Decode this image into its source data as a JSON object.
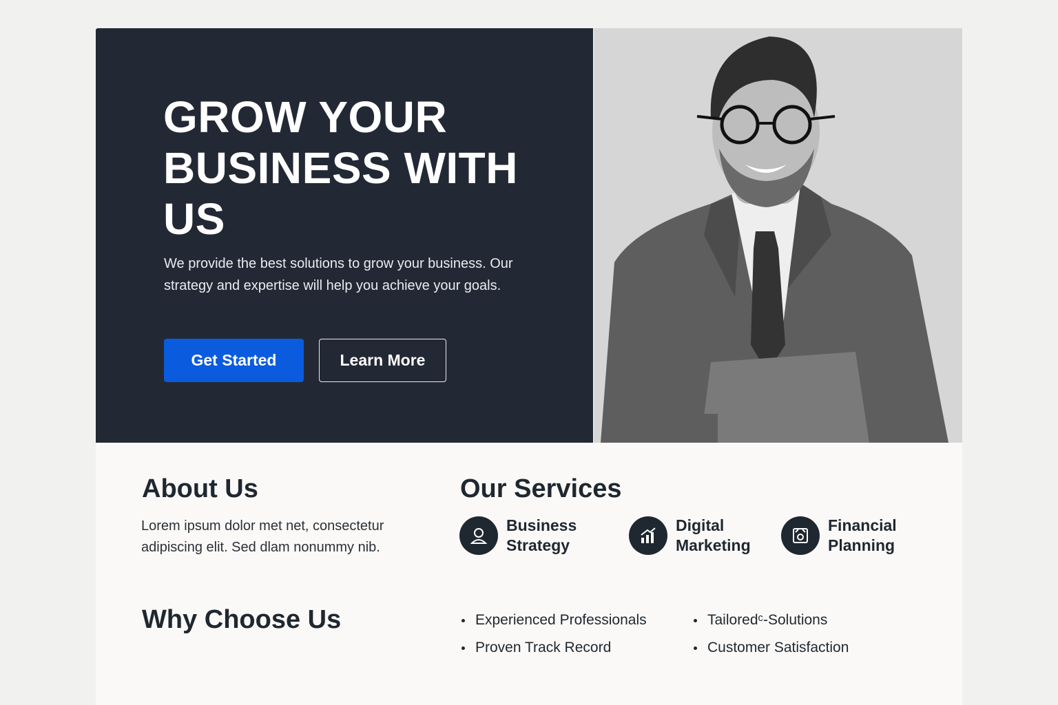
{
  "hero": {
    "title": "GROW YOUR BUSINESS WITH US",
    "text": "We provide the best solutions to grow your business. Our strategy and expertise will help you achieve your goals.",
    "primary_button": "Get Started",
    "secondary_button": "Learn More"
  },
  "about": {
    "title": "About Us",
    "text": "Lorem ipsum dolor met net, consectetur adipiscing elit. Sed dlam nonummy nib."
  },
  "services": {
    "title": "Our Services",
    "items": [
      {
        "label": "Business Strategy",
        "icon": "person-icon"
      },
      {
        "label": "Digital Marketing",
        "icon": "bar-chart-icon"
      },
      {
        "label": "Financial Planning",
        "icon": "finance-icon"
      }
    ]
  },
  "why": {
    "title": "Why Choose Us",
    "points": [
      "Experienced Professionals",
      "Proven Track Record",
      "Tailoredᶜ-Solutions",
      "Customer Satisfaction"
    ]
  },
  "colors": {
    "hero_bg": "#232934",
    "primary": "#0b5bde",
    "text_dark": "#1f2730",
    "page_bg": "#faf9f7"
  }
}
